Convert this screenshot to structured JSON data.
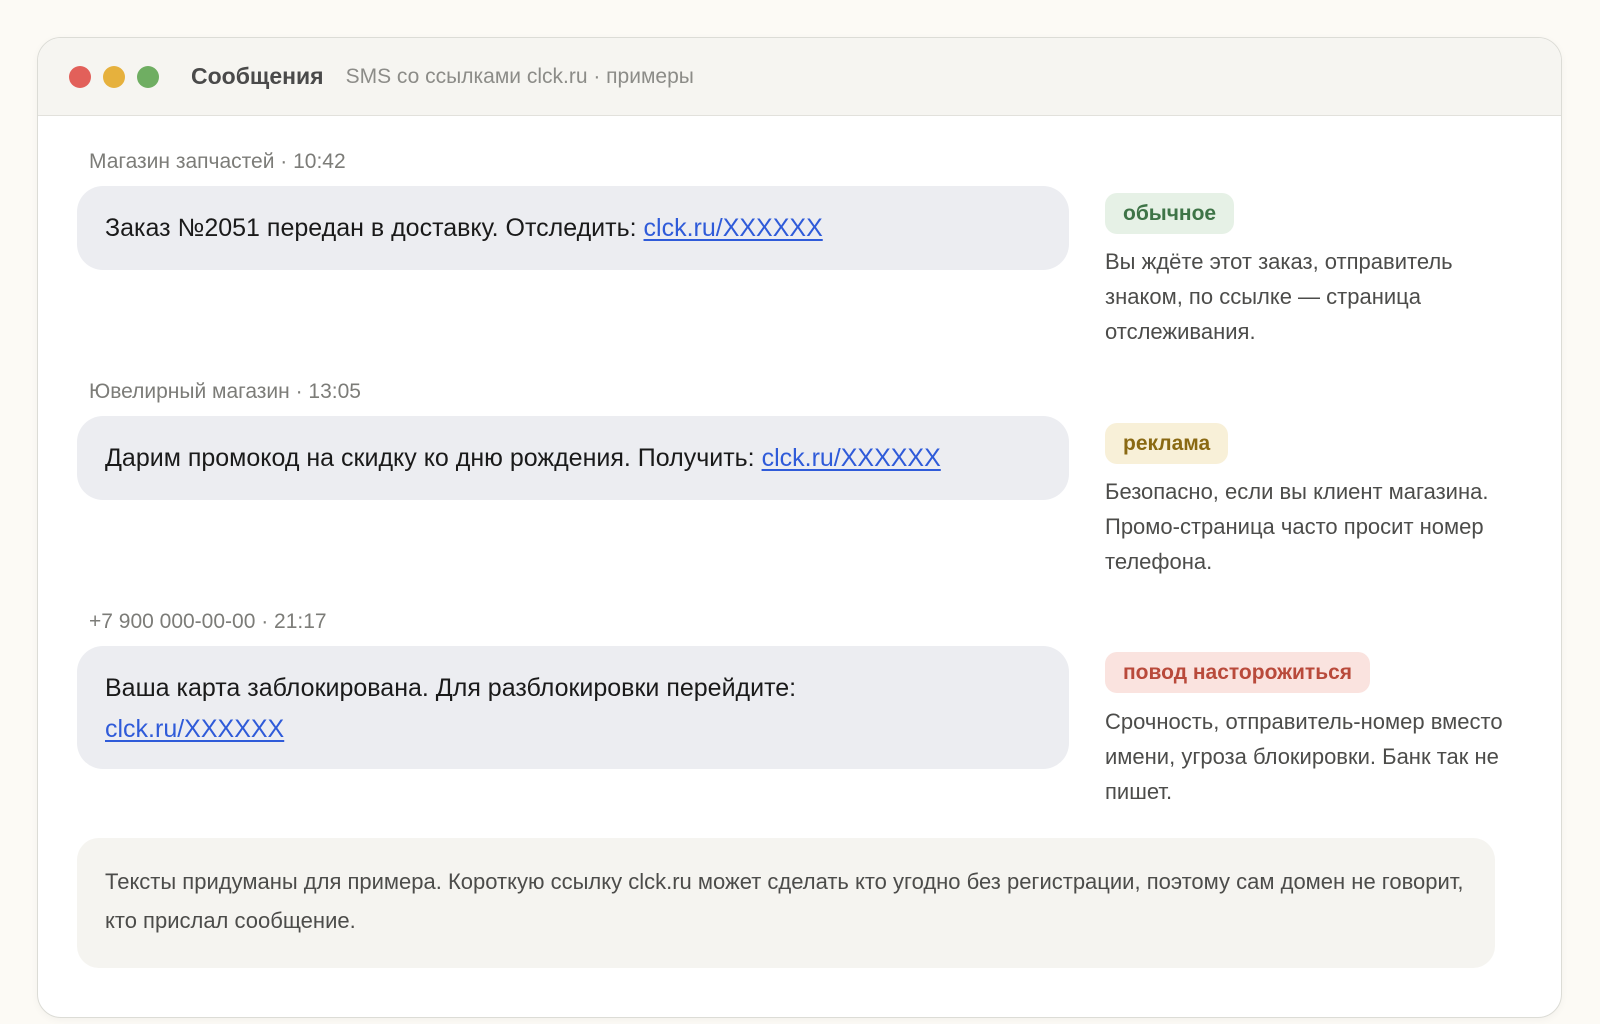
{
  "window": {
    "title": "Сообщения",
    "subtitle": "SMS со ссылками clck.ru · примеры"
  },
  "messages": [
    {
      "sender_time": "Магазин запчастей · 10:42",
      "text": "Заказ №2051 передан в доставку. Отследить: ",
      "link": "clck.ru/XXXXXX",
      "tag": "обычное",
      "note": "Вы ждёте этот заказ, отправитель знаком, по ссылке — страница отслеживания."
    },
    {
      "sender_time": "Ювелирный магазин · 13:05",
      "text": "Дарим промокод на скидку ко дню рождения. Получить: ",
      "link": "clck.ru/XXXXXX",
      "tag": "реклама",
      "note": "Безопасно, если вы клиент магазина. Промо-страница часто просит номер телефона."
    },
    {
      "sender_time": "+7 900 000-00-00 · 21:17",
      "text": "Ваша карта заблокирована. Для разблокировки перейдите: ",
      "link": "clck.ru/XXXXXX",
      "tag": "повод насторожиться",
      "note": "Срочность, отправитель-номер вместо имени, угроза блокировки. Банк так не пишет."
    }
  ],
  "footnote": "Тексты придуманы для примера. Короткую ссылку clck.ru может сделать кто угодно без регистрации, поэтому сам домен не говорит, кто прислал сообщение.",
  "colors": {
    "link": "#2f5bd9",
    "tag_normal": "#3e7447",
    "tag_ad": "#8a6913",
    "tag_warn": "#b94a3b"
  }
}
